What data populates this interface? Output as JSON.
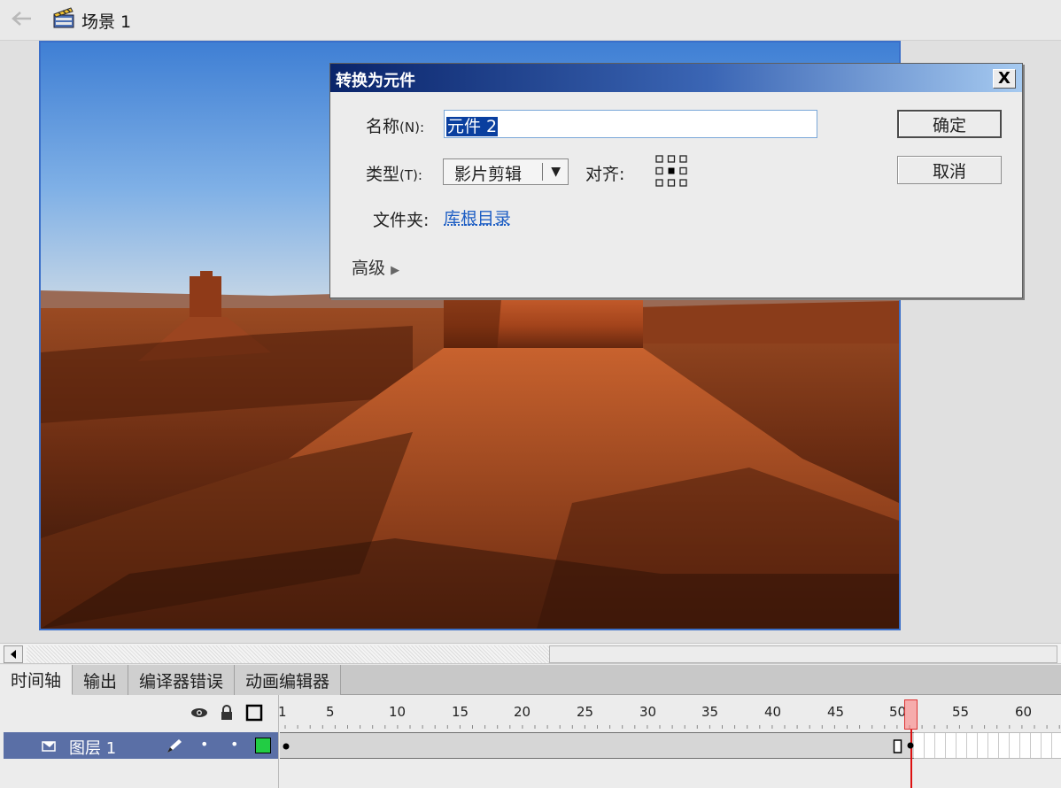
{
  "editbar": {
    "scene_label": "场景 1"
  },
  "timeline_panel": {
    "tabs": [
      "时间轴",
      "输出",
      "编译器错误",
      "动画编辑器"
    ],
    "active_tab": 0,
    "ruler_labels": [
      "1",
      "5",
      "10",
      "15",
      "20",
      "25",
      "30",
      "35",
      "40",
      "45",
      "50",
      "55",
      "60"
    ],
    "current_frame": 51,
    "layer": {
      "name": "图层 1",
      "outline_color": "#22cc44"
    }
  },
  "dialog": {
    "title": "转换为元件",
    "close_label": "X",
    "name_label": "名称",
    "name_shortcut": "(N):",
    "name_value": "元件 2",
    "type_label": "类型",
    "type_shortcut": "(T):",
    "type_value": "影片剪辑",
    "align_label": "对齐:",
    "folder_label": "文件夹:",
    "folder_value": "库根目录",
    "advanced_label": "高级",
    "ok_label": "确定",
    "cancel_label": "取消"
  },
  "colors": {
    "titlebar_start": "#0a246a",
    "titlebar_end": "#a6caf0",
    "stage_border": "#3a6fc9",
    "playhead": "#dd1111",
    "layer_row": "#5a6fa6"
  }
}
